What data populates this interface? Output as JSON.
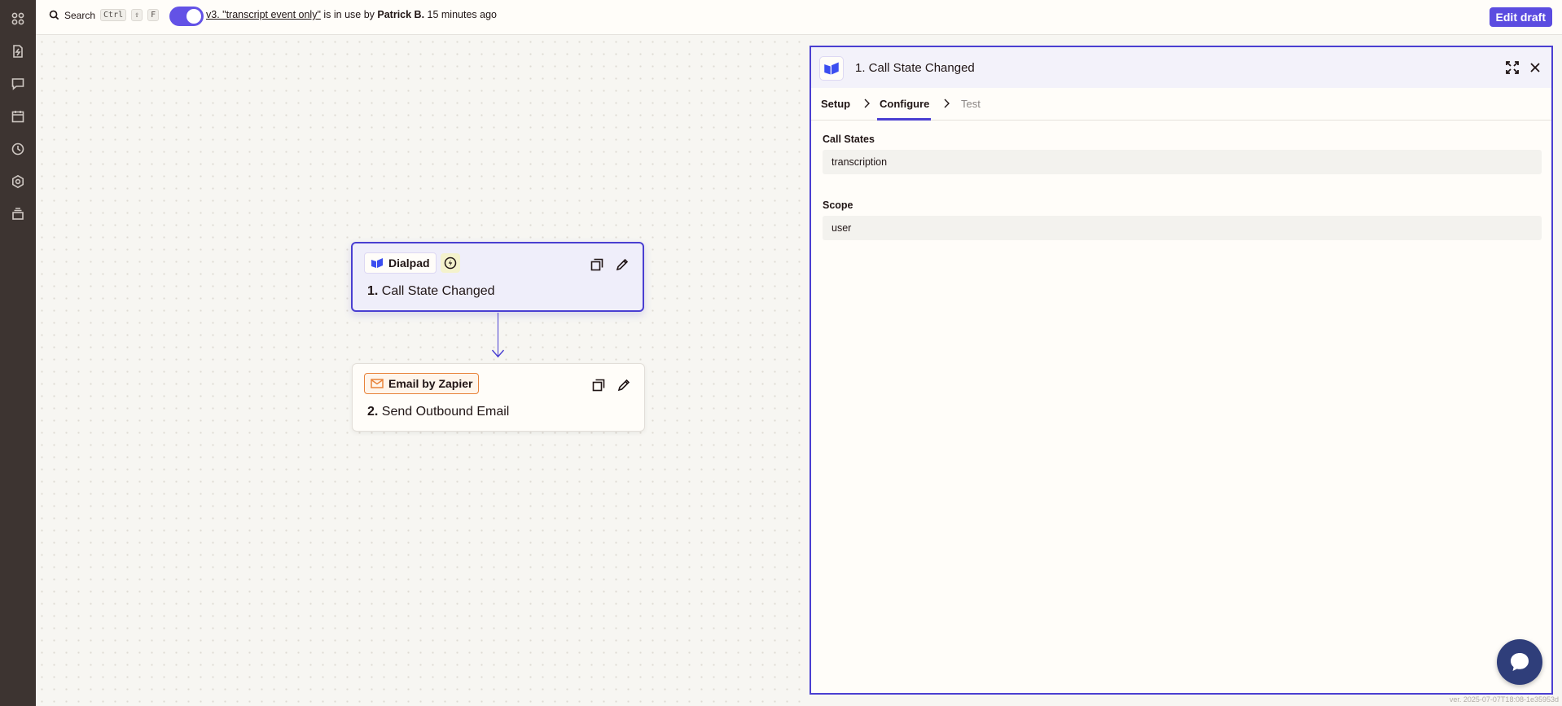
{
  "rail": {
    "items": [
      {
        "icon": "apps-grid-icon"
      },
      {
        "icon": "zap-file-icon"
      },
      {
        "icon": "chat-icon"
      },
      {
        "icon": "calendar-icon"
      },
      {
        "icon": "history-icon"
      },
      {
        "icon": "settings-icon"
      },
      {
        "icon": "stack-icon"
      }
    ]
  },
  "topbar": {
    "search_label": "Search",
    "shortcut": [
      "Ctrl",
      "⇧",
      "F"
    ],
    "toggle_on": true,
    "version_link": "v3. \"transcript event only\"",
    "status_mid": " is in use by ",
    "user": "Patrick B.",
    "time_ago": " 15 minutes ago",
    "edit_button": "Edit draft"
  },
  "canvas": {
    "steps": [
      {
        "app": "Dialpad",
        "number": "1.",
        "title": "Call State Changed",
        "is_trigger": true,
        "selected": true
      },
      {
        "app": "Email by Zapier",
        "number": "2.",
        "title": "Send Outbound Email",
        "is_trigger": false,
        "selected": false
      }
    ]
  },
  "panel": {
    "title": "1. Call State Changed",
    "tabs": {
      "setup": "Setup",
      "configure": "Configure",
      "test": "Test",
      "active": "configure"
    },
    "fields": [
      {
        "label": "Call States",
        "value": "transcription"
      },
      {
        "label": "Scope",
        "value": "user"
      }
    ]
  },
  "footer": {
    "version": "ver. 2025-07-07T18:08-1e35953d"
  },
  "colors": {
    "accent": "#4a3fd1",
    "rail": "#3d3431",
    "email_orange": "#e8833a",
    "dialpad_blue": "#3b4ef0"
  }
}
